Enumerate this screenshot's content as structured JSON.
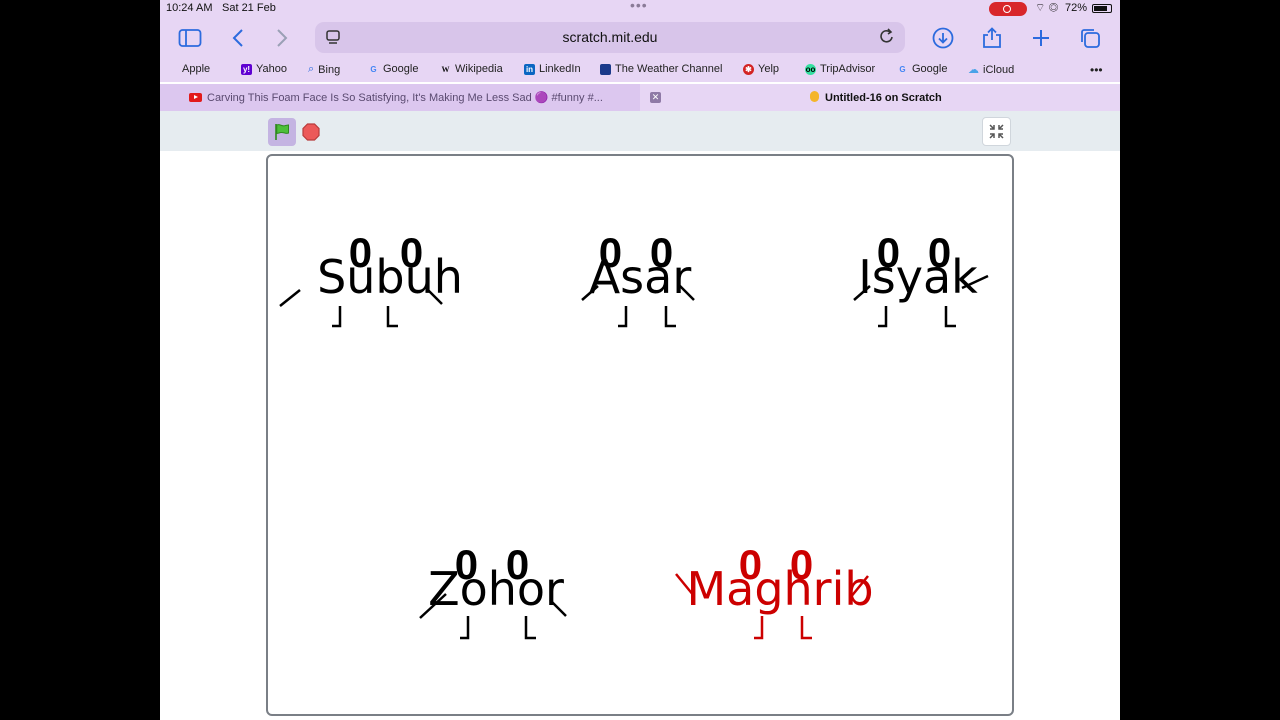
{
  "status": {
    "time": "10:24 AM",
    "date": "Sat 21 Feb",
    "battery": "72%"
  },
  "browser": {
    "url": "scratch.mit.edu",
    "bookmarks": [
      "Apple",
      "Yahoo",
      "Bing",
      "Google",
      "Wikipedia",
      "LinkedIn",
      "The Weather Channel",
      "Yelp",
      "TripAdvisor",
      "Google",
      "iCloud"
    ],
    "tabs": [
      {
        "title": "Carving This Foam Face Is So Satisfying, It's Making Me Less Sad 🟣 #funny #...",
        "active": false
      },
      {
        "title": "Untitled-16 on Scratch",
        "active": true
      }
    ],
    "more": "•••"
  },
  "stage": {
    "sprites": [
      {
        "word": "Subuh",
        "eyes": "0 0",
        "color": "#000000"
      },
      {
        "word": "Asar",
        "eyes": "0 0",
        "color": "#000000"
      },
      {
        "word": "Isyak",
        "eyes": "0 0",
        "color": "#000000"
      },
      {
        "word": "Zohor",
        "eyes": "0 0",
        "color": "#000000"
      },
      {
        "word": "Maghrib",
        "eyes": "0 0",
        "color": "#cc0000"
      }
    ]
  }
}
